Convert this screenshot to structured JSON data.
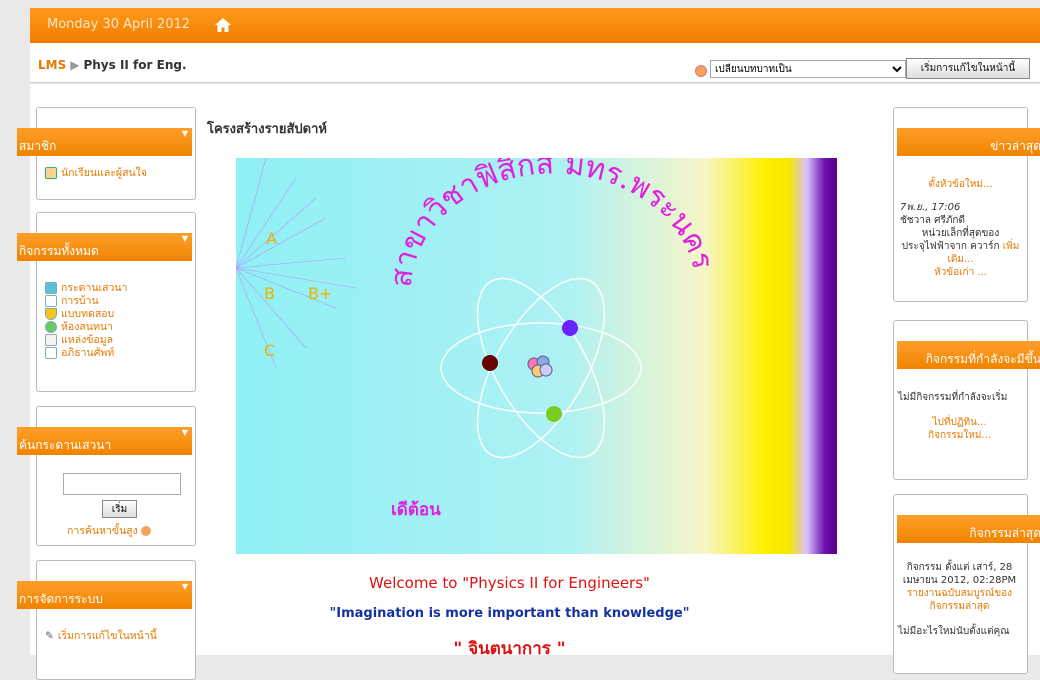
{
  "topbar": {
    "date": "Monday 30 April 2012"
  },
  "nav": {
    "root": "LMS",
    "course": "Phys II for Eng.",
    "role_select": "เปลี่ยนบทบาทเป็น",
    "edit_button": "เริ่มการแก้ไขในหน้านี้"
  },
  "left_blocks": {
    "members": {
      "title": "สมาชิก",
      "items": [
        "นักเรียนและผู้สนใจ"
      ]
    },
    "activities": {
      "title": "กิจกรรมทั้งหมด",
      "items": [
        "กระดานเสวนา",
        "การบ้าน",
        "แบบทดสอบ",
        "ห้องสนทนา",
        "แหล่งข้อมูล",
        "อภิธานศัพท์"
      ]
    },
    "search": {
      "title": "ค้นกระดานเสวนา",
      "button": "เริ่ม",
      "advanced": "การค้นหาขั้นสูง"
    },
    "admin": {
      "title": "การจัดการระบบ",
      "items": [
        "เริ่มการแก้ไขในหน้านี้"
      ]
    }
  },
  "main": {
    "title": "โครงสร้างรายสัปดาห์",
    "banner": {
      "arc_text": "สาขาวิชาฟิสิกส์ มทร.พระนคร",
      "grades": [
        "A",
        "B",
        "B+",
        "C"
      ],
      "logo_text": "เดีต้อน"
    },
    "welcome": "Welcome to \"Physics II for Engineers\"",
    "quote": "\"Imagination is more important than knowledge\"",
    "think": "\" จินตนาการ \""
  },
  "right_blocks": {
    "news": {
      "title": "ข่าวล่าสุด",
      "new_topic": "ตั้งหัวข้อใหม่...",
      "date": "7พ.ย., 17:06",
      "author": "ชัชวาล ศรีภักดี",
      "snippet": "หน่วยเล็กที่สุดของประจุไฟฟ้าจาก ควาร์ก",
      "more": "เพิ่มเติม...",
      "old": "หัวข้อเก่า ..."
    },
    "upcoming": {
      "title": "กิจกรรมที่กำลังจะมีขึ้น",
      "empty": "ไม่มีกิจกรรมที่กำลังจะเริ่ม",
      "calendar": "ไปที่ปฏิทิน...",
      "new_event": "กิจกรรมใหม่..."
    },
    "recent": {
      "title": "กิจกรรมล่าสุด",
      "since": "กิจกรรม ตั้งแต่ เสาร์, 28 เมษายน 2012, 02:28PM",
      "full_report": "รายงานฉบับสมบูรณ์ของกิจกรรมล่าสุด",
      "nothing": "ไม่มีอะไรใหม่นับตั้งแต่คุณ"
    }
  },
  "colors": {
    "accent": "#f08400",
    "link": "#e57a00"
  }
}
